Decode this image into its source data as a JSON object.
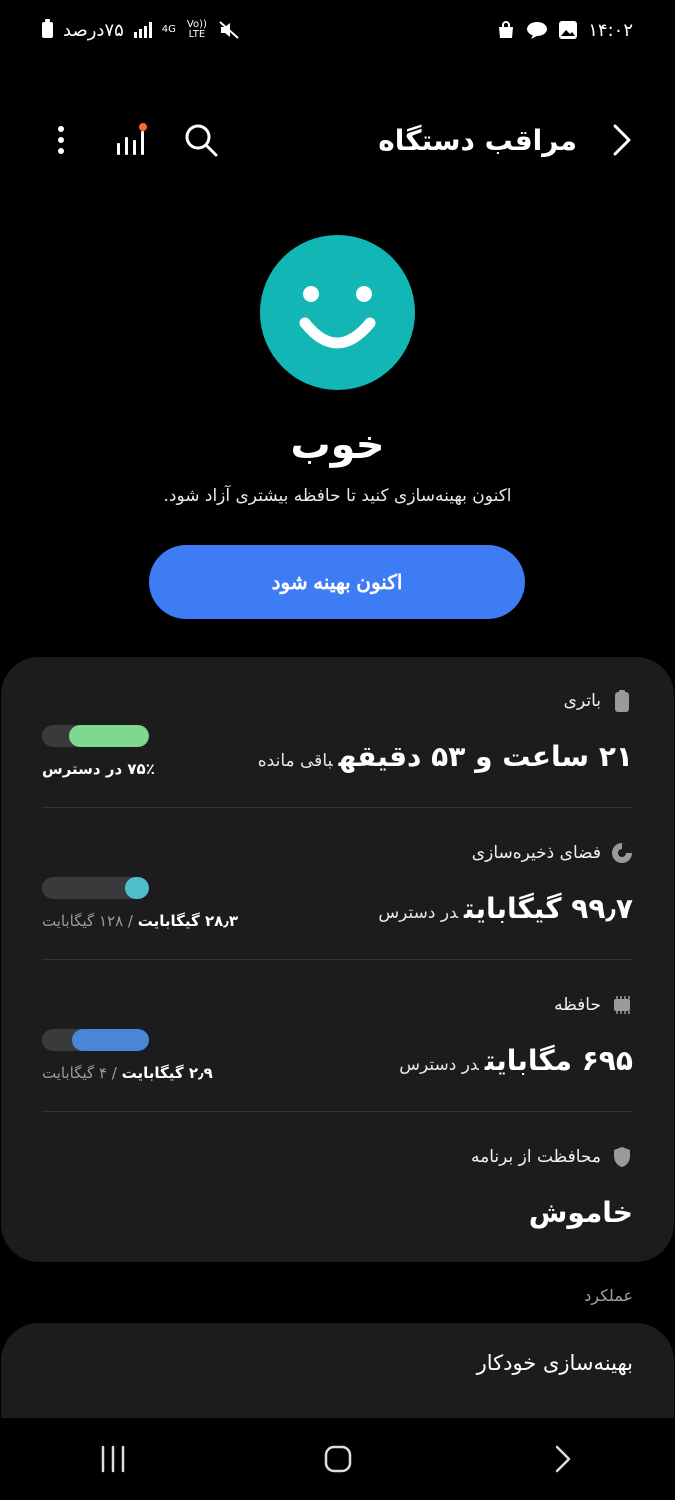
{
  "status_bar": {
    "time": "۱۴:۰۲",
    "battery_text": "۷۵درصد",
    "network": "4G",
    "volte": "Vo)) LTE"
  },
  "header": {
    "title": "مراقب دستگاه"
  },
  "summary": {
    "status_word": "خوب",
    "subtitle": "اکنون بهینه‌سازی کنید تا حافظه بیشتری آزاد شود.",
    "button_label": "اکنون بهینه شود",
    "face_color": "#12b7b5"
  },
  "battery": {
    "label": "باتری",
    "value": "۲۱ ساعت و ۵۳ دقیقه",
    "suffix": "باقی مانده",
    "caption": "۷۵٪ در دسترس",
    "fill_fraction": 0.75,
    "color": "#7fd88f"
  },
  "storage": {
    "label": "فضای ذخیره‌سازی",
    "value": "۹۹٫۷ گیگابایت",
    "suffix": "در دسترس",
    "caption_used": "۲۸٫۳ گیگابایت",
    "caption_total": "/ ۱۲۸ گیگابایت",
    "fill_fraction": 0.22,
    "color": "#4fc0c9"
  },
  "memory": {
    "label": "حافظه",
    "value": "۶۹۵ مگابایت",
    "suffix": "در دسترس",
    "caption_used": "۲٫۹ گیگابایت",
    "caption_total": "/ ۴ گیگابایت",
    "fill_fraction": 0.72,
    "color": "#4a86d8"
  },
  "app_protection": {
    "label": "محافظت از برنامه",
    "value": "خاموش"
  },
  "performance": {
    "section_label": "عملکرد",
    "auto_optimize": "بهینه‌سازی خودکار"
  }
}
